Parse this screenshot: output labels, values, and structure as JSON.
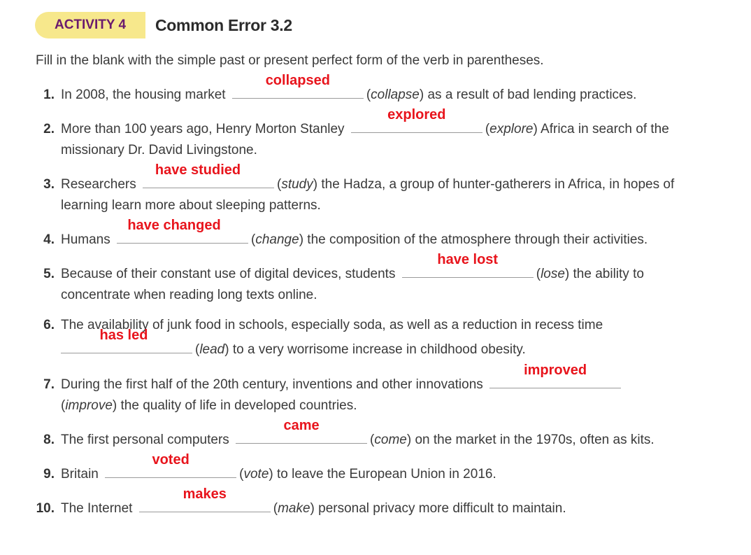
{
  "header": {
    "badge": "ACTIVITY 4",
    "title": "Common Error 3.2"
  },
  "instruction": "Fill in the blank with the simple past or present perfect form of the verb in parentheses.",
  "items": [
    {
      "num": "1.",
      "before": "In 2008, the housing market",
      "answer": "collapsed",
      "verb": "collapse",
      "after": " as a result of bad lending practices."
    },
    {
      "num": "2.",
      "before": "More than 100 years ago, Henry Morton Stanley",
      "answer": "explored",
      "verb": "explore",
      "after": " Africa in search of the",
      "line2": "missionary Dr. David Livingstone."
    },
    {
      "num": "3.",
      "before": "Researchers",
      "answer": "have studied",
      "verb": "study",
      "after": " the Hadza, a group of hunter-gatherers in Africa, in hopes of",
      "line2": "learning learn more about sleeping patterns."
    },
    {
      "num": "4.",
      "before": "Humans",
      "answer": "have changed",
      "verb": "change",
      "after": " the composition of the atmosphere through their activities."
    },
    {
      "num": "5.",
      "before": "Because of their constant use of digital devices, students",
      "answer": "have lost",
      "verb": "lose",
      "after": " the ability to",
      "line2": "concentrate when reading long texts online."
    },
    {
      "num": "6.",
      "before": "The availability of junk food in schools, especially soda, as well as a reduction in recess time",
      "answer": "has led",
      "verb": "lead",
      "after": " to a very worrisome increase in childhood obesity."
    },
    {
      "num": "7.",
      "before": "During the first half of the 20th century, inventions and other innovations",
      "answer": "improved",
      "verb": "improve",
      "after": " the quality of life in developed countries."
    },
    {
      "num": "8.",
      "before": "The first personal computers",
      "answer": "came",
      "verb": "come",
      "after": " on the market in the 1970s, often as kits."
    },
    {
      "num": "9.",
      "before": "Britain",
      "answer": "voted",
      "verb": "vote",
      "after": " to leave the European Union in 2016."
    },
    {
      "num": "10.",
      "before": "The Internet",
      "answer": "makes",
      "verb": "make",
      "after": " personal privacy more difficult to maintain."
    }
  ]
}
